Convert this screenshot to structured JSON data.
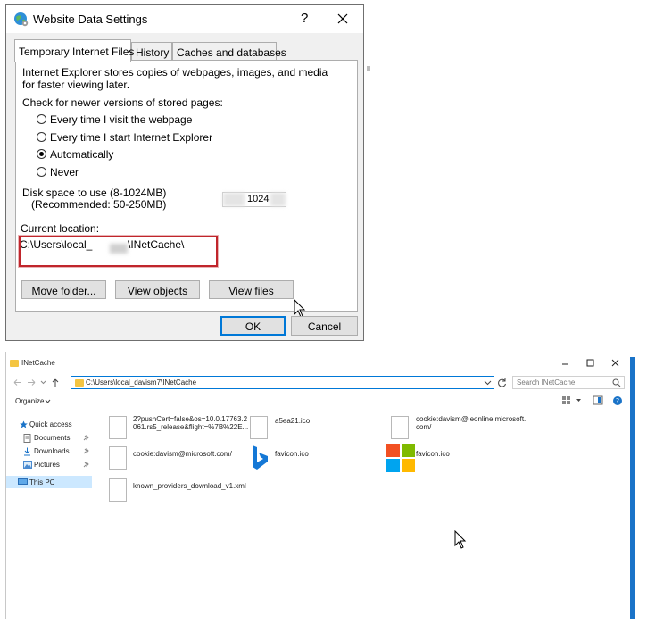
{
  "dialog": {
    "title": "Website Data Settings",
    "help": "?",
    "tabs": [
      {
        "label": "Temporary Internet Files"
      },
      {
        "label": "History"
      },
      {
        "label": "Caches and databases"
      }
    ],
    "description_line1": "Internet Explorer stores copies of webpages, images, and media",
    "description_line2": "for faster viewing later.",
    "check_heading": "Check for newer versions of stored pages:",
    "radios": [
      {
        "label": "Every time I visit the webpage",
        "checked": false
      },
      {
        "label": "Every time I start Internet Explorer",
        "checked": false
      },
      {
        "label": "Automatically",
        "checked": true
      },
      {
        "label": "Never",
        "checked": false
      }
    ],
    "disk_label": "Disk space to use (8-1024MB)",
    "disk_recommended": "(Recommended: 50-250MB)",
    "disk_value": "1024",
    "location_label": "Current location:",
    "location_path_start": "C:\\Users\\local_",
    "location_path_end": "\\INetCache\\",
    "buttons": {
      "move_folder": "Move folder...",
      "view_objects": "View objects",
      "view_files": "View files",
      "ok": "OK",
      "cancel": "Cancel"
    },
    "highlight_color": "#c0252b"
  },
  "explorer": {
    "title": "INetCache",
    "address": "C:\\Users\\local_davism7\\INetCache",
    "search_placeholder": "Search INetCache",
    "organize": "Organize",
    "nav": [
      {
        "label": "Quick access",
        "icon": "star-icon"
      },
      {
        "label": "Documents",
        "icon": "documents-icon"
      },
      {
        "label": "Downloads",
        "icon": "download-icon"
      },
      {
        "label": "Pictures",
        "icon": "pictures-icon"
      },
      {
        "label": "This PC",
        "icon": "computer-icon"
      }
    ],
    "files": [
      {
        "line1": "2?pushCert=false&os=10.0.17763.2",
        "line2": "061.rs5_release&flight=%7B%22E...",
        "icon": "file-icon"
      },
      {
        "line1": "a5ea21.ico",
        "line2": "",
        "icon": "file-icon"
      },
      {
        "line1": "cookie:davism@ieonline.microsoft.",
        "line2": "com/",
        "icon": "file-icon"
      },
      {
        "line1": "cookie:davism@microsoft.com/",
        "line2": "",
        "icon": "file-icon"
      },
      {
        "line1": "favicon.ico",
        "line2": "",
        "icon": "bing-icon"
      },
      {
        "line1": "favicon.ico",
        "line2": "",
        "icon": "microsoft-logo-icon"
      },
      {
        "line1": "known_providers_download_v1.xml",
        "line2": "",
        "icon": "file-icon"
      }
    ]
  }
}
